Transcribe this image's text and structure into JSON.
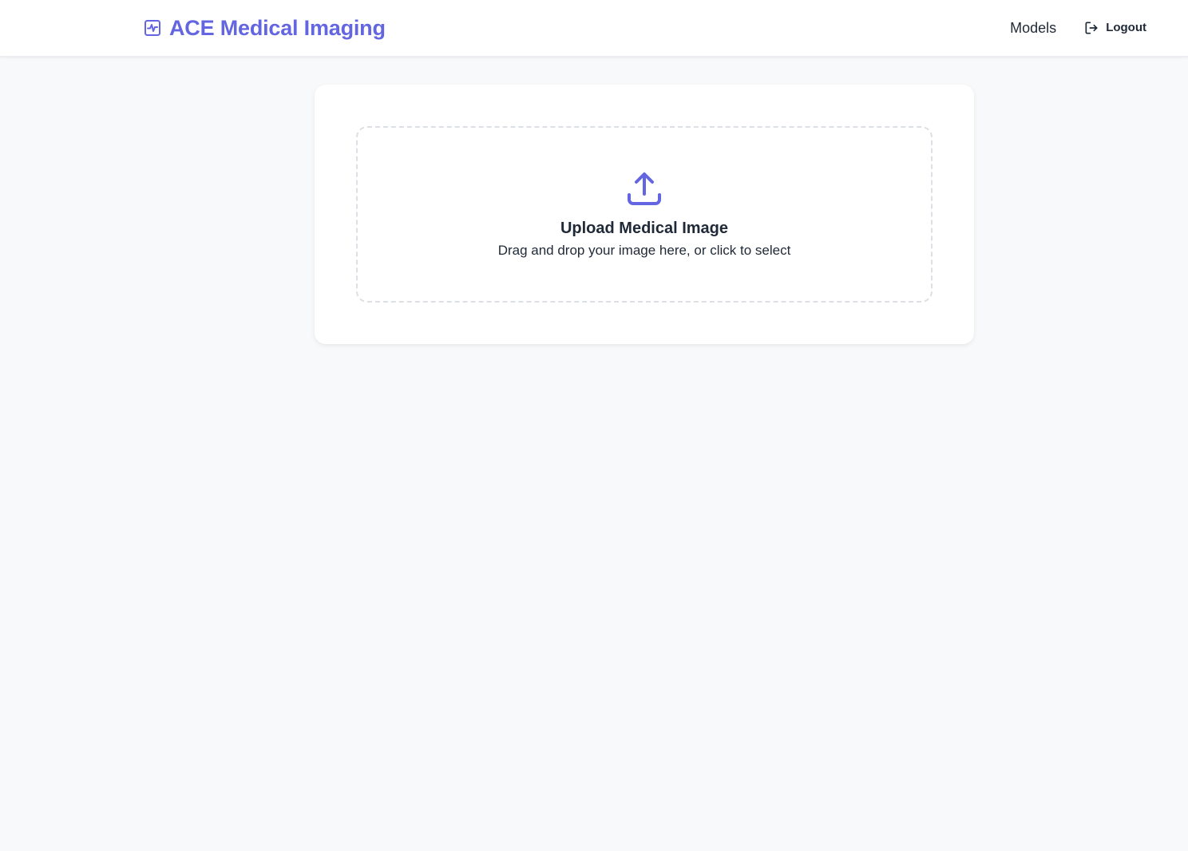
{
  "header": {
    "brand_title": "ACE Medical Imaging",
    "brand_icon": "activity-pulse-icon",
    "nav": {
      "models_label": "Models",
      "logout_label": "Logout",
      "logout_icon": "logout-icon"
    }
  },
  "upload": {
    "icon": "upload-icon",
    "title": "Upload Medical Image",
    "subtitle": "Drag and drop your image here, or click to select"
  },
  "colors": {
    "accent": "#6366e0",
    "text": "#1f2937",
    "background": "#f8f9fa",
    "card": "#ffffff",
    "dashed_border": "#dcdfe4"
  }
}
